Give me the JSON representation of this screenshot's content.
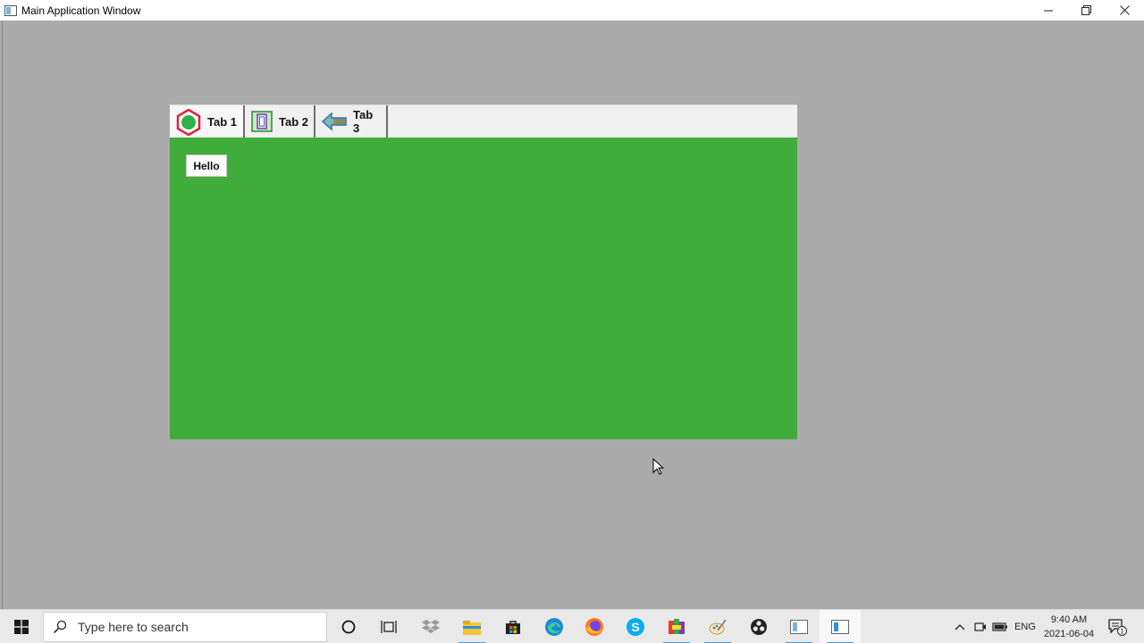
{
  "window": {
    "title": "Main Application Window",
    "controls": {
      "minimize_icon": "minimize-icon",
      "restore_icon": "restore-icon",
      "close_icon": "close-icon"
    }
  },
  "tabs": [
    {
      "label": "Tab 1",
      "icon": "green-hexagon-icon",
      "active": true
    },
    {
      "label": "Tab 2",
      "icon": "framed-picture-icon",
      "active": false
    },
    {
      "label": "Tab 3",
      "icon": "left-arrow-icon",
      "active": false
    }
  ],
  "panel": {
    "background": "#40ad3a",
    "button_label": "Hello"
  },
  "taskbar": {
    "search_placeholder": "Type here to search",
    "apps": [
      "cortana-icon",
      "task-view-icon",
      "dropbox-icon",
      "file-explorer-icon",
      "store-icon",
      "edge-icon",
      "firefox-icon",
      "skype-icon",
      "colorful-app-icon",
      "paint-icon",
      "obs-icon",
      "window-app-icon",
      "active-window-app-icon"
    ],
    "tray": {
      "language": "ENG",
      "time": "9:40 AM",
      "date": "2021-06-04",
      "notification_count": "1"
    }
  }
}
